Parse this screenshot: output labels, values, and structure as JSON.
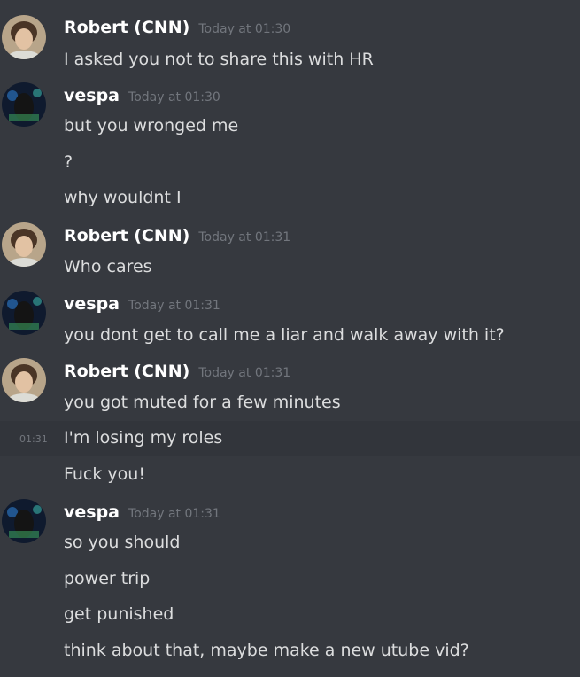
{
  "messages": [
    {
      "author": "Robert (CNN)",
      "timestamp": "Today at 01:30",
      "lines": [
        "I asked you not to share this with HR"
      ]
    },
    {
      "author": "vespa",
      "timestamp": "Today at 01:30",
      "lines": [
        "but you wronged me",
        "?",
        "why wouldnt I"
      ]
    },
    {
      "author": "Robert (CNN)",
      "timestamp": "Today at 01:31",
      "lines": [
        "Who cares"
      ]
    },
    {
      "author": "vespa",
      "timestamp": "Today at 01:31",
      "lines": [
        "you dont get to call me a liar and walk away with it?"
      ]
    },
    {
      "author": "Robert (CNN)",
      "timestamp": "Today at 01:31",
      "lines": [
        "you got muted for a few minutes",
        "I'm losing my roles",
        "Fuck you!"
      ],
      "hover_time": "01:31"
    },
    {
      "author": "vespa",
      "timestamp": "Today at 01:31",
      "lines": [
        "so you should",
        "power trip",
        "get punished",
        "think about that, maybe make a new utube vid?"
      ]
    }
  ],
  "colors": {
    "background": "#36393f",
    "author": "#ffffff",
    "text": "#dcddde",
    "timestamp": "#72767d"
  },
  "icons": {
    "robert_avatar": "robert-avatar-image",
    "vespa_avatar": "vespa-avatar-image"
  }
}
